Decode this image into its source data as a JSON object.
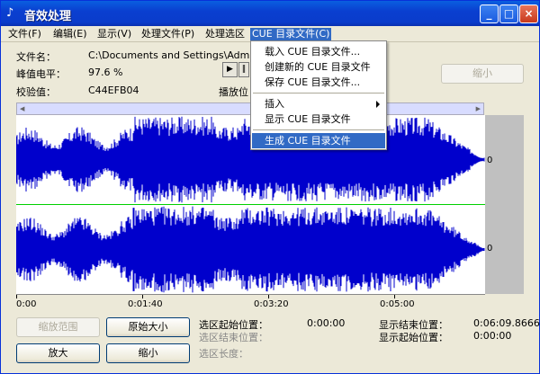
{
  "window": {
    "title": "音效处理"
  },
  "menu": {
    "items": [
      "文件(F)",
      "编辑(E)",
      "显示(V)",
      "处理文件(P)",
      "处理选区",
      "CUE 目录文件(C)"
    ]
  },
  "info": {
    "filename_label": "文件名：",
    "filename_value": "C:\\Documents and Settings\\Administrato",
    "peak_label": "峰值电平：",
    "peak_value": "97.6 %",
    "checksum_label": "校验值：",
    "checksum_value": "C44EFB04",
    "play_label": "播放位"
  },
  "buttons": {
    "shrink_top": "缩小",
    "zoom_range": "缩放范围",
    "original_size": "原始大小",
    "zoom_in": "放大",
    "zoom_out": "缩小"
  },
  "dropdown": {
    "items": [
      "载入 CUE 目录文件...",
      "创建新的 CUE 目录文件",
      "保存 CUE 目录文件...",
      "插入",
      "显示 CUE 目录文件",
      "生成 CUE 目录文件"
    ]
  },
  "tracks": {
    "zero_label": "0"
  },
  "timeline": {
    "labels": [
      "0:00",
      "0:01:40",
      "0:03:20",
      "0:05:00"
    ]
  },
  "selection": {
    "start_label": "选区起始位置：",
    "start_value": "0:00:00",
    "end_label": "选区结束位置：",
    "end_value": "",
    "length_label": "选区长度：",
    "length_value": "",
    "show_end_label": "显示结束位置：",
    "show_end_value": "0:06:09.8666",
    "show_start_label": "显示起始位置：",
    "show_start_value": "0:00:00"
  },
  "colors": {
    "wave": "#0000cc",
    "title_bar": "#0a3fd0",
    "menu_highlight": "#316ac5"
  }
}
